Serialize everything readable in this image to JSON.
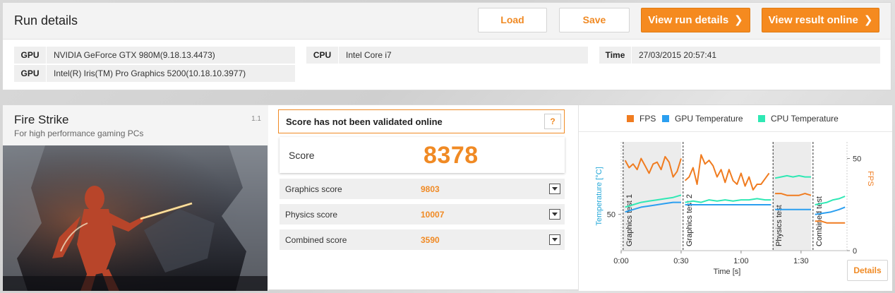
{
  "run_details": {
    "title": "Run details",
    "buttons": {
      "load": "Load",
      "save": "Save",
      "view_run_details": "View run details",
      "view_result_online": "View result online"
    },
    "info": {
      "gpu1_label": "GPU",
      "gpu1_value": "NVIDIA GeForce GTX 980M(9.18.13.4473)",
      "gpu2_label": "GPU",
      "gpu2_value": "Intel(R) Iris(TM) Pro Graphics 5200(10.18.10.3977)",
      "cpu_label": "CPU",
      "cpu_value": "Intel Core i7",
      "time_label": "Time",
      "time_value": "27/03/2015 20:57:41"
    }
  },
  "benchmark": {
    "name": "Fire Strike",
    "subtitle": "For high performance gaming PCs",
    "version": "1.1",
    "validation_text": "Score has not been validated online",
    "help_label": "?",
    "score_label": "Score",
    "score_value": "8378",
    "subscores": [
      {
        "label": "Graphics score",
        "value": "9803"
      },
      {
        "label": "Physics score",
        "value": "10007"
      },
      {
        "label": "Combined score",
        "value": "3590"
      }
    ]
  },
  "chart_legend": {
    "fps": "FPS",
    "gpu_temp": "GPU Temperature",
    "cpu_temp": "CPU Temperature"
  },
  "details_label": "Details",
  "colors": {
    "accent": "#f08a24",
    "fps": "#f07c20",
    "gpu_temp": "#2b9ff0",
    "cpu_temp": "#2fe8b4"
  },
  "chart_data": {
    "type": "line",
    "xlabel": "Time [s]",
    "ylabel_left": "Temperature [°C]",
    "ylabel_right": "FPS",
    "xlim": [
      0,
      113
    ],
    "x_ticks": [
      {
        "value": 0,
        "label": "0:00"
      },
      {
        "value": 30,
        "label": "0:30"
      },
      {
        "value": 60,
        "label": "1:00"
      },
      {
        "value": 90,
        "label": "1:30"
      }
    ],
    "ylim_left": [
      35,
      80
    ],
    "left_ticks": [
      50
    ],
    "ylim_right": [
      0,
      59
    ],
    "right_ticks": [
      0,
      50
    ],
    "sections": [
      {
        "label": "Graphics test 1",
        "start": 1,
        "end": 30
      },
      {
        "label": "Graphics test 2",
        "start": 31,
        "end": 75
      },
      {
        "label": "Physics test",
        "start": 76,
        "end": 95
      },
      {
        "label": "Combined test",
        "start": 96,
        "end": 113
      }
    ],
    "series": [
      {
        "name": "FPS",
        "axis": "right",
        "segments": [
          {
            "x": [
              2,
              4,
              6,
              8,
              10,
              12,
              14,
              16,
              18,
              20,
              22,
              24,
              26,
              28,
              30
            ],
            "y": [
              49,
              45,
              47,
              44,
              50,
              46,
              42,
              47,
              48,
              44,
              51,
              48,
              40,
              43,
              50
            ]
          },
          {
            "x": [
              32,
              34,
              36,
              38,
              40,
              42,
              44,
              46,
              48,
              50,
              52,
              54,
              56,
              58,
              60,
              62,
              64,
              66,
              68,
              70,
              72,
              74
            ],
            "y": [
              38,
              40,
              45,
              36,
              52,
              47,
              49,
              46,
              40,
              44,
              37,
              44,
              38,
              36,
              42,
              35,
              40,
              33,
              36,
              36,
              39,
              42
            ]
          },
          {
            "x": [
              77,
              80,
              83,
              86,
              89,
              92,
              95
            ],
            "y": [
              31,
              31,
              30,
              30,
              30,
              31,
              30
            ]
          },
          {
            "x": [
              97,
              100,
              103,
              106,
              109,
              112
            ],
            "y": [
              16,
              16,
              15,
              15,
              15,
              15
            ]
          }
        ]
      },
      {
        "name": "GPU Temperature",
        "axis": "left",
        "segments": [
          {
            "x": [
              2,
              6,
              10,
              14,
              18,
              22,
              26,
              30
            ],
            "y": [
              51,
              52,
              53,
              53.5,
              54,
              54.5,
              55,
              55
            ]
          },
          {
            "x": [
              32,
              40,
              48,
              56,
              64,
              72,
              75
            ],
            "y": [
              54,
              54,
              54,
              54,
              54,
              54,
              54
            ]
          },
          {
            "x": [
              77,
              83,
              89,
              95
            ],
            "y": [
              52,
              52,
              52,
              52
            ]
          },
          {
            "x": [
              97,
              101,
              105,
              109,
              112
            ],
            "y": [
              50,
              50.5,
              51,
              52,
              53
            ]
          }
        ]
      },
      {
        "name": "CPU Temperature",
        "axis": "left",
        "segments": [
          {
            "x": [
              2,
              6,
              10,
              14,
              18,
              22,
              26,
              30
            ],
            "y": [
              53,
              54,
              55,
              55.5,
              56,
              56.5,
              57,
              58
            ]
          },
          {
            "x": [
              32,
              36,
              40,
              44,
              48,
              52,
              56,
              60,
              64,
              68,
              72,
              75
            ],
            "y": [
              55,
              55.5,
              55,
              56,
              55.5,
              56,
              55.5,
              56,
              56,
              56.5,
              56,
              56
            ]
          },
          {
            "x": [
              77,
              80,
              83,
              86,
              89,
              92,
              95
            ],
            "y": [
              65,
              65.5,
              66,
              65.5,
              66,
              65.5,
              65.5
            ]
          },
          {
            "x": [
              97,
              100,
              103,
              106,
              109,
              112
            ],
            "y": [
              54,
              54.5,
              55,
              56,
              56.5,
              57.5
            ]
          }
        ]
      }
    ]
  }
}
